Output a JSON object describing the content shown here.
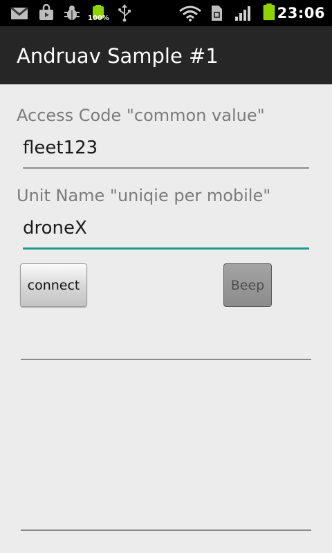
{
  "status_bar": {
    "icons": [
      "gmail-icon",
      "shopping-bag-icon",
      "bug-icon",
      "battery-charging-icon",
      "usb-icon",
      "wifi-icon",
      "sim-card-icon",
      "signal-icon",
      "battery-icon"
    ],
    "battery_percent": "100%",
    "time": "23:06"
  },
  "action_bar": {
    "title": "Andruav Sample #1"
  },
  "form": {
    "access_code_label": "Access Code \"common value\"",
    "access_code_value": "fleet123",
    "unit_name_label": "Unit Name \"uniqie per mobile\"",
    "unit_name_value": "droneX"
  },
  "buttons": {
    "connect_label": "connect",
    "beep_label": "Beep"
  },
  "colors": {
    "focus_accent": "#1e9b8c",
    "battery_green": "#8fd400"
  }
}
